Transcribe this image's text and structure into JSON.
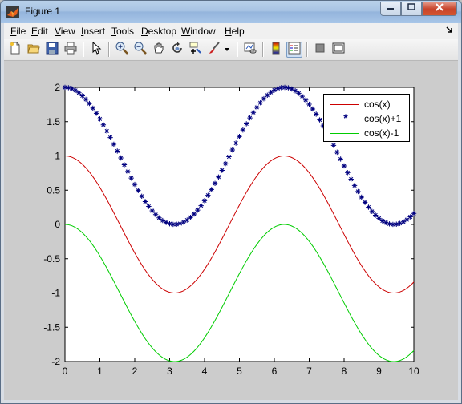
{
  "window": {
    "title": "Figure 1",
    "minimize_icon": "minimize-icon",
    "maximize_icon": "maximize-icon",
    "close_icon": "close-icon"
  },
  "menubar": {
    "items": [
      "File",
      "Edit",
      "View",
      "Insert",
      "Tools",
      "Desktop",
      "Window",
      "Help"
    ],
    "dock_icon": "dock-arrow-icon"
  },
  "toolbar": {
    "buttons": [
      {
        "icon": "new-figure-icon"
      },
      {
        "icon": "open-file-icon"
      },
      {
        "icon": "save-icon"
      },
      {
        "icon": "print-icon"
      },
      {
        "icon": "edit-plot-arrow-icon"
      },
      {
        "icon": "zoom-in-icon"
      },
      {
        "icon": "zoom-out-icon"
      },
      {
        "icon": "pan-hand-icon"
      },
      {
        "icon": "rotate-3d-icon"
      },
      {
        "icon": "data-cursor-icon"
      },
      {
        "icon": "brush-icon"
      },
      {
        "icon": "link-plot-icon"
      },
      {
        "icon": "colorbar-icon"
      },
      {
        "icon": "legend-icon"
      },
      {
        "icon": "hide-plot-tools-icon"
      },
      {
        "icon": "show-plot-tools-icon"
      }
    ]
  },
  "chart_data": {
    "type": "line",
    "title": "",
    "xlabel": "",
    "ylabel": "",
    "xlim": [
      0,
      10
    ],
    "ylim": [
      -2,
      2
    ],
    "x_ticks": [
      "0",
      "1",
      "2",
      "3",
      "4",
      "5",
      "6",
      "7",
      "8",
      "9",
      "10"
    ],
    "y_ticks": [
      "2",
      "1.5",
      "1",
      "0.5",
      "0",
      "-0.5",
      "-1",
      "-1.5",
      "-2"
    ],
    "x_step": 0.05,
    "legend_position": "top-right",
    "grid": false,
    "series": [
      {
        "name": "cos(x)",
        "function": "cos(x)",
        "color": "#cc0000",
        "style": "line"
      },
      {
        "name": "cos(x)+1",
        "function": "cos(x)+1",
        "color": "#00007f",
        "style": "star-markers",
        "marker_step": 0.1
      },
      {
        "name": "cos(x)-1",
        "function": "cos(x)-1",
        "color": "#00cc00",
        "style": "line"
      }
    ]
  }
}
